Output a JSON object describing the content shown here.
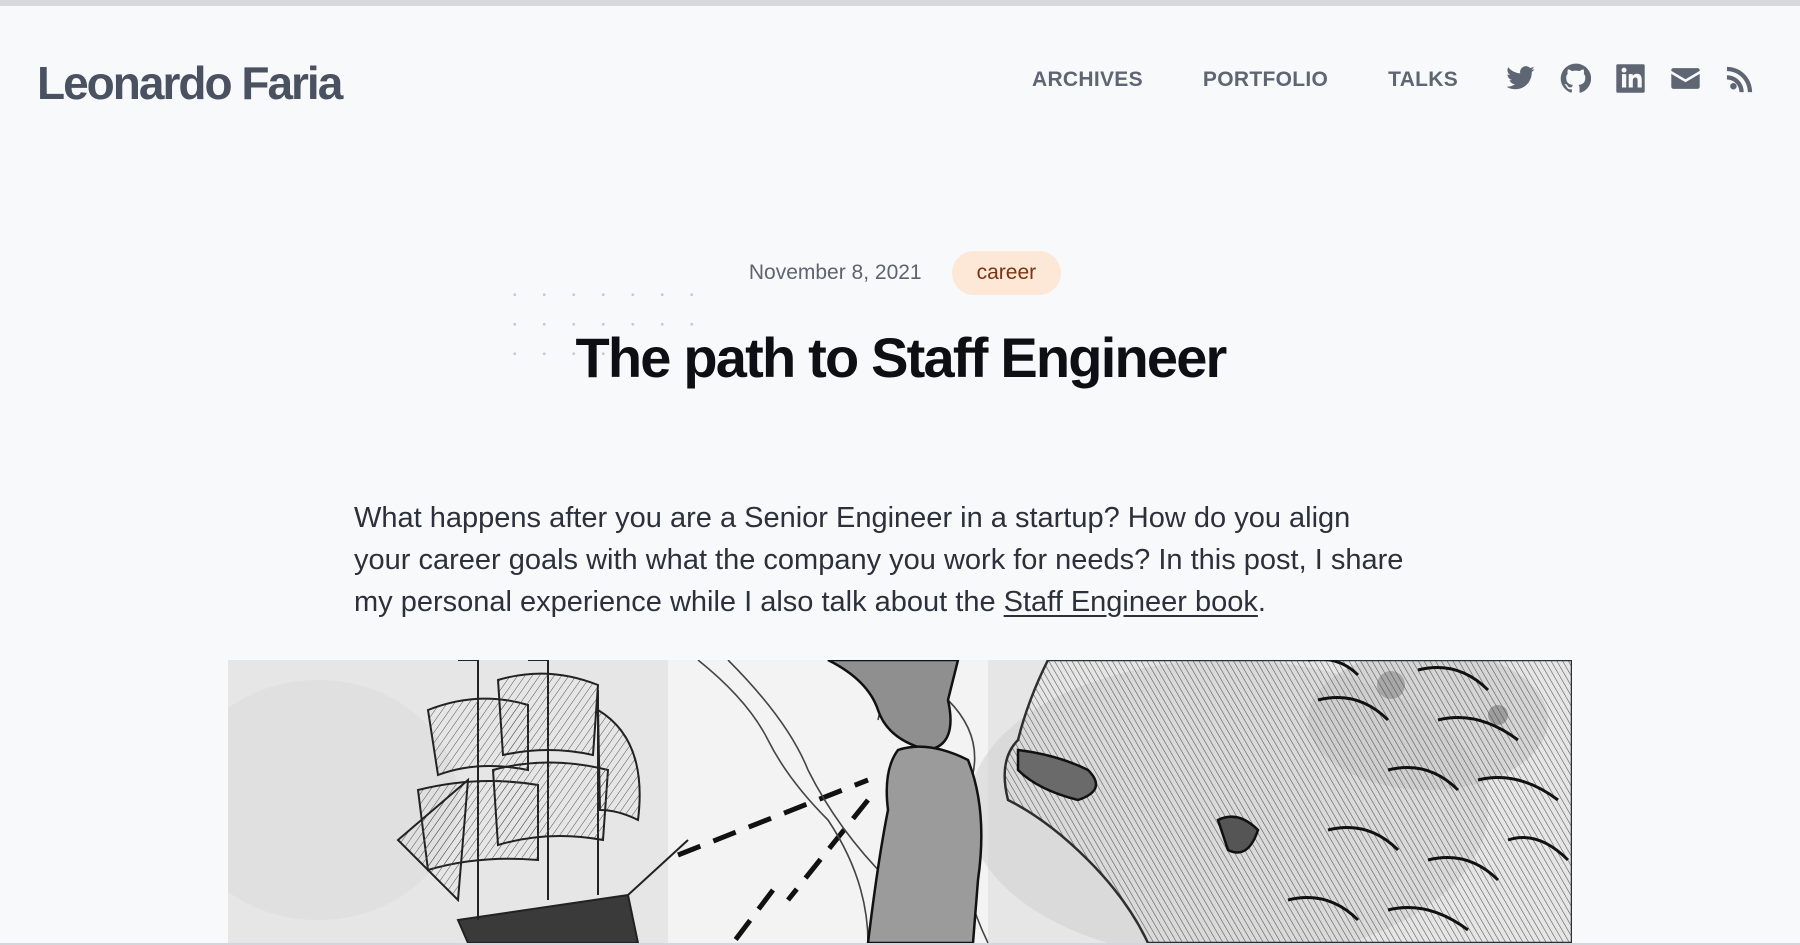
{
  "site": {
    "title": "Leonardo Faria"
  },
  "nav": {
    "items": [
      {
        "label": "ARCHIVES"
      },
      {
        "label": "PORTFOLIO"
      },
      {
        "label": "TALKS"
      }
    ]
  },
  "social": {
    "icons": [
      "twitter-icon",
      "github-icon",
      "linkedin-icon",
      "email-icon",
      "rss-icon"
    ]
  },
  "post": {
    "date": "November 8, 2021",
    "tag": "career",
    "title": "The path to Staff Engineer",
    "intro_text": "What happens after you are a Senior Engineer in a startup? How do you align your career goals with what the company you work for needs? In this post, I share my personal experience while I also talk about the ",
    "intro_link": "Staff Engineer book",
    "intro_end": "."
  },
  "colors": {
    "background": "#f8f9fb",
    "tag_bg": "#fde7d6",
    "tag_text": "#7a3413",
    "nav_text": "#5f6673"
  }
}
